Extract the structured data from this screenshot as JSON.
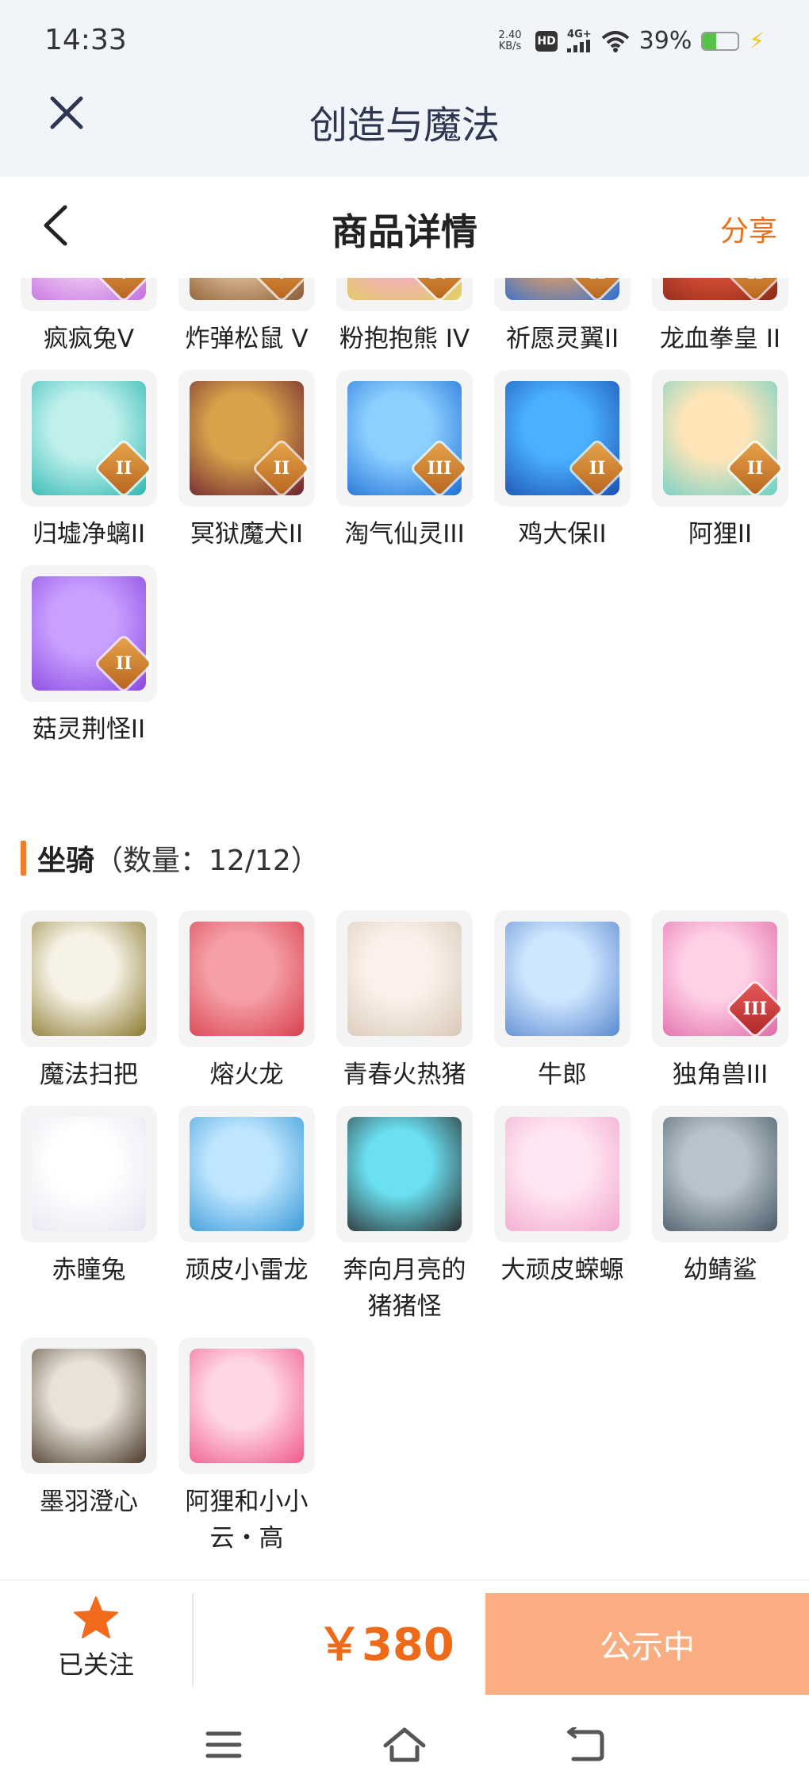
{
  "status_bar": {
    "time": "14:33",
    "net_speed_value": "2.40",
    "net_speed_unit": "KB/s",
    "hd": "HD",
    "signal": "4G+",
    "battery": "39%",
    "battery_level": 0.39
  },
  "app_bar": {
    "title": "创造与魔法",
    "close_icon": "close-icon"
  },
  "page_header": {
    "title": "商品详情",
    "share": "分享",
    "back_icon": "chevron-left-icon"
  },
  "pets": [
    {
      "name": "疯疯兔V",
      "badge": "V",
      "colors": [
        "#f2d6f4",
        "#c46fe0"
      ]
    },
    {
      "name": "炸弹松鼠 V",
      "badge": "V",
      "colors": [
        "#e9c9a0",
        "#8a5a34"
      ]
    },
    {
      "name": "粉抱抱熊 IV",
      "badge": "IV",
      "colors": [
        "#f7a7d0",
        "#e0d25a"
      ]
    },
    {
      "name": "祈愿灵翼II",
      "badge": "II",
      "colors": [
        "#f2a25a",
        "#2a6fd6"
      ]
    },
    {
      "name": "龙血拳皇 II",
      "badge": "II",
      "colors": [
        "#e8553a",
        "#8a2a1a"
      ]
    },
    {
      "name": "归墟净螭II",
      "badge": "II",
      "colors": [
        "#bff0ec",
        "#2fb7b0"
      ]
    },
    {
      "name": "冥狱魔犬II",
      "badge": "II",
      "colors": [
        "#d9a24a",
        "#6a2030"
      ]
    },
    {
      "name": "淘气仙灵III",
      "badge": "III",
      "colors": [
        "#8cd0ff",
        "#1f6fd6"
      ]
    },
    {
      "name": "鸡大保II",
      "badge": "II",
      "colors": [
        "#4ab0ff",
        "#1b4fb0"
      ]
    },
    {
      "name": "阿狸II",
      "badge": "II",
      "colors": [
        "#ffe5b8",
        "#6ad0c8"
      ]
    },
    {
      "name": "菇灵荆怪II",
      "badge": "II",
      "colors": [
        "#c8a0ff",
        "#8a48e0"
      ]
    }
  ],
  "mounts_section": {
    "title": "坐骑",
    "count_label": "（数量：12/12）"
  },
  "mounts": [
    {
      "name": "魔法扫把",
      "badge": "",
      "colors": [
        "#f7f2e6",
        "#8a7a30"
      ]
    },
    {
      "name": "熔火龙",
      "badge": "",
      "colors": [
        "#f5a0a8",
        "#d8404e"
      ]
    },
    {
      "name": "青春火热猪",
      "badge": "",
      "colors": [
        "#fbf1ea",
        "#d8c8b8"
      ]
    },
    {
      "name": "牛郎",
      "badge": "",
      "colors": [
        "#cfe6ff",
        "#5a8ad0"
      ]
    },
    {
      "name": "独角兽III",
      "badge": "III",
      "colors": [
        "#ffd0e6",
        "#e06aa8"
      ]
    },
    {
      "name": "赤瞳兔",
      "badge": "",
      "colors": [
        "#ffffff",
        "#e6e6f2"
      ]
    },
    {
      "name": "顽皮小雷龙",
      "badge": "",
      "colors": [
        "#bfe6ff",
        "#3a9ad8"
      ]
    },
    {
      "name": "奔向月亮的\n猪猪怪",
      "badge": "",
      "colors": [
        "#6ae0f0",
        "#2a2a2a"
      ]
    },
    {
      "name": "大顽皮蝾螈",
      "badge": "",
      "colors": [
        "#ffe6f2",
        "#f2a8d0"
      ]
    },
    {
      "name": "幼鲭鲨",
      "badge": "",
      "colors": [
        "#b8c4cc",
        "#4a5a66"
      ]
    },
    {
      "name": "墨羽澄心",
      "badge": "",
      "colors": [
        "#e8e2d8",
        "#4a3a2a"
      ]
    },
    {
      "name": "阿狸和小小\n云・高",
      "badge": "",
      "colors": [
        "#ffd6e6",
        "#f05a8a"
      ]
    }
  ],
  "bottom_bar": {
    "follow_label": "已关注",
    "price": "￥380",
    "status_button": "公示中",
    "star_color": "#f26a1b",
    "accent": "#ee6a18"
  },
  "nav_bar": {
    "menu_icon": "menu-icon",
    "home_icon": "home-icon",
    "back_icon": "back-icon"
  }
}
